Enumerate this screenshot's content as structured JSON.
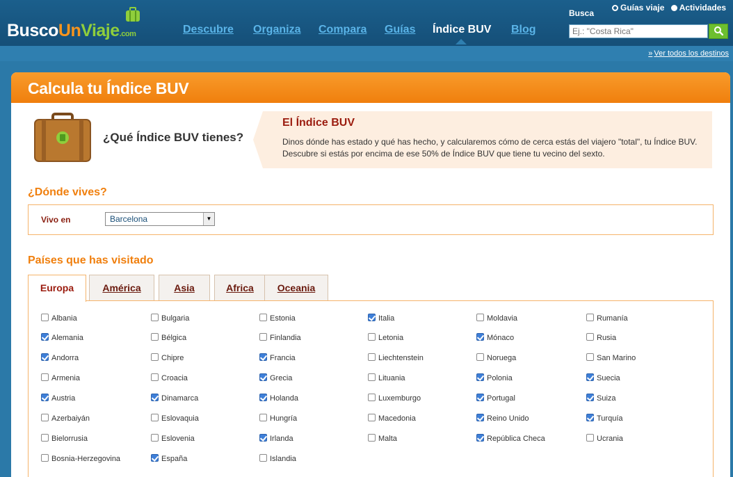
{
  "header": {
    "logo": {
      "part1": "Busco",
      "part2": "Un",
      "part3": "Viaje",
      "part4": ".com"
    },
    "nav": [
      "Descubre",
      "Organiza",
      "Compara",
      "Guías",
      "Índice BUV",
      "Blog"
    ],
    "active_nav": "Índice BUV",
    "search": {
      "label": "Busca",
      "option1": "Guías viaje",
      "option2": "Actividades",
      "placeholder": "Ej.: \"Costa Rica\"",
      "button_icon": "search-icon"
    },
    "ver_todos": "Ver todos los destinos"
  },
  "panel": {
    "title": "Calcula tu Índice BUV",
    "intro_question": "¿Qué Índice BUV tienes?",
    "intro_title": "El Índice BUV",
    "intro_text": "Dinos dónde has estado y qué has hecho, y calcularemos cómo de cerca estás del viajero \"total\", tu Índice BUV. Descubre si estás por encima de ese 50% de Índice BUV que tiene tu vecino del sexto.",
    "section_live": "¿Dónde vives?",
    "vivo_label": "Vivo en",
    "vivo_value": "Barcelona",
    "section_countries": "Países que has visitado",
    "tabs": [
      "Europa",
      "América",
      "Asia",
      "Africa",
      "Oceania"
    ],
    "active_tab": "Europa"
  },
  "countries": [
    [
      {
        "name": "Albania",
        "checked": false
      },
      {
        "name": "Alemania",
        "checked": true
      },
      {
        "name": "Andorra",
        "checked": true
      },
      {
        "name": "Armenia",
        "checked": false
      },
      {
        "name": "Austria",
        "checked": true
      },
      {
        "name": "Azerbaiyán",
        "checked": false
      },
      {
        "name": "Bielorrusia",
        "checked": false
      },
      {
        "name": "Bosnia-Herzegovina",
        "checked": false
      }
    ],
    [
      {
        "name": "Bulgaria",
        "checked": false
      },
      {
        "name": "Bélgica",
        "checked": false
      },
      {
        "name": "Chipre",
        "checked": false
      },
      {
        "name": "Croacia",
        "checked": false
      },
      {
        "name": "Dinamarca",
        "checked": true
      },
      {
        "name": "Eslovaquia",
        "checked": false
      },
      {
        "name": "Eslovenia",
        "checked": false
      },
      {
        "name": "España",
        "checked": true
      }
    ],
    [
      {
        "name": "Estonia",
        "checked": false
      },
      {
        "name": "Finlandia",
        "checked": false
      },
      {
        "name": "Francia",
        "checked": true
      },
      {
        "name": "Grecia",
        "checked": true
      },
      {
        "name": "Holanda",
        "checked": true
      },
      {
        "name": "Hungría",
        "checked": false
      },
      {
        "name": "Irlanda",
        "checked": true
      },
      {
        "name": "Islandia",
        "checked": false
      }
    ],
    [
      {
        "name": "Italia",
        "checked": true
      },
      {
        "name": "Letonia",
        "checked": false
      },
      {
        "name": "Liechtenstein",
        "checked": false
      },
      {
        "name": "Lituania",
        "checked": false
      },
      {
        "name": "Luxemburgo",
        "checked": false
      },
      {
        "name": "Macedonia",
        "checked": false
      },
      {
        "name": "Malta",
        "checked": false
      }
    ],
    [
      {
        "name": "Moldavia",
        "checked": false
      },
      {
        "name": "Mónaco",
        "checked": true
      },
      {
        "name": "Noruega",
        "checked": false
      },
      {
        "name": "Polonia",
        "checked": true
      },
      {
        "name": "Portugal",
        "checked": true
      },
      {
        "name": "Reino Unido",
        "checked": true
      },
      {
        "name": "República Checa",
        "checked": true
      }
    ],
    [
      {
        "name": "Rumanía",
        "checked": false
      },
      {
        "name": "Rusia",
        "checked": false
      },
      {
        "name": "San Marino",
        "checked": false
      },
      {
        "name": "Suecia",
        "checked": true
      },
      {
        "name": "Suiza",
        "checked": true
      },
      {
        "name": "Turquía",
        "checked": true
      },
      {
        "name": "Ucrania",
        "checked": false
      }
    ]
  ]
}
